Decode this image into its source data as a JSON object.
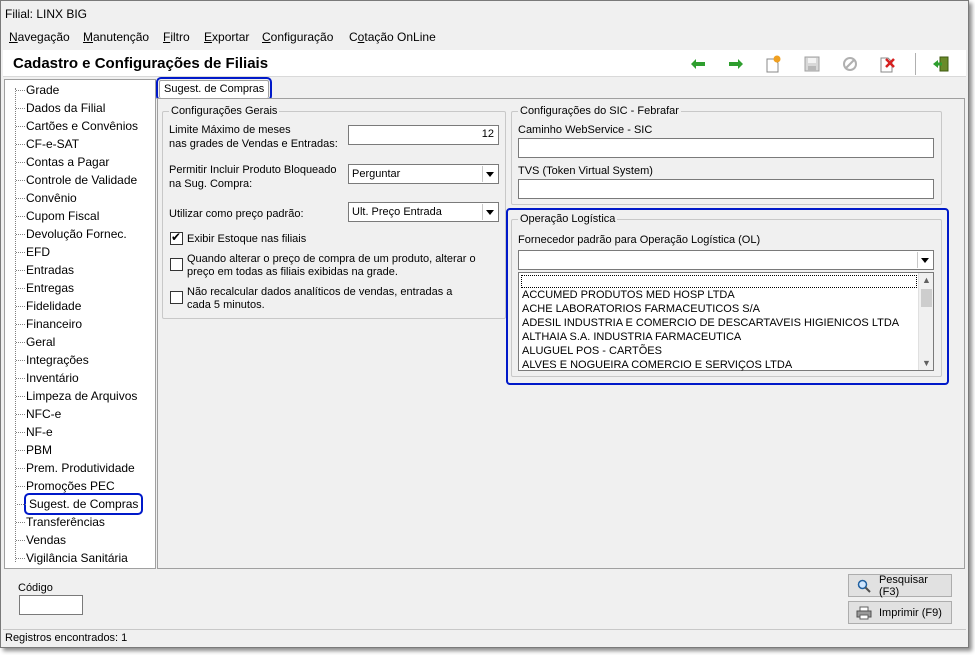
{
  "window": {
    "title": "Filial: LINX  BIG"
  },
  "menu": [
    {
      "label": "Navegação",
      "key": "N"
    },
    {
      "label": "Manutenção",
      "key": "M"
    },
    {
      "label": "Filtro",
      "key": "F"
    },
    {
      "label": "Exportar",
      "key": "E"
    },
    {
      "label": "Configuração",
      "key": "C"
    },
    {
      "label": "Cotação OnLine",
      "key": "o"
    }
  ],
  "header": {
    "title": "Cadastro e Configurações de Filiais"
  },
  "toolbar": {
    "icons": [
      "arrow-left-icon",
      "arrow-right-icon",
      "new-document-icon",
      "save-icon",
      "cancel-icon",
      "delete-icon",
      "exit-icon"
    ],
    "colors": {
      "arrow": "#2e9e2e",
      "delete": "#d62020",
      "new": "#f0a020"
    }
  },
  "sidebar": {
    "items": [
      "Grade",
      "Dados da Filial",
      "Cartões e Convênios",
      "CF-e-SAT",
      "Contas a Pagar",
      "Controle de Validade",
      "Convênio",
      "Cupom Fiscal",
      "Devolução Fornec.",
      "EFD",
      "Entradas",
      "Entregas",
      "Fidelidade",
      "Financeiro",
      "Geral",
      "Integrações",
      "Inventário",
      "Limpeza de Arquivos",
      "NFC-e",
      "NF-e",
      "PBM",
      "Prem. Produtividade",
      "Promoções PEC",
      "Sugest. de Compras",
      "Transferências",
      "Vendas",
      "Vigilância Sanitária"
    ],
    "selected": "Sugest. de Compras"
  },
  "tab": {
    "label": "Sugest. de Compras"
  },
  "general": {
    "title": "Configurações Gerais",
    "limit_label_1": "Limite Máximo de meses",
    "limit_label_2": "nas grades de Vendas e Entradas:",
    "limit_value": "12",
    "blocked_label_1": "Permitir Incluir Produto Bloqueado",
    "blocked_label_2": "na Sug. Compra:",
    "blocked_value": "Perguntar",
    "price_label": "Utilizar como preço padrão:",
    "price_value": "Ult. Preço Entrada",
    "chk_stock": {
      "label": "Exibir Estoque nas filiais",
      "checked": true
    },
    "chk_price_1": "Quando alterar o preço de compra de um produto, alterar o",
    "chk_price_2": "preço em todas as filiais exibidas na grade.",
    "chk_recalc_1": "Não recalcular dados analíticos de vendas, entradas a",
    "chk_recalc_2": "cada 5 minutos."
  },
  "sic": {
    "title": "Configurações do SIC - Febrafar",
    "ws_label": "Caminho WebService - SIC",
    "ws_value": "",
    "tvs_label": "TVS (Token Virtual System)",
    "tvs_value": ""
  },
  "logistics": {
    "title": "Operação Logística",
    "supplier_label": "Fornecedor padrão para Operação Logística (OL)",
    "supplier_value": "",
    "options": [
      "ACCUMED PRODUTOS MED HOSP LTDA",
      "ACHE LABORATORIOS FARMACEUTICOS S/A",
      "ADESIL INDUSTRIA E COMERCIO DE DESCARTAVEIS HIGIENICOS LTDA",
      "ALTHAIA S.A. INDUSTRIA FARMACEUTICA",
      "ALUGUEL POS - CARTÕES",
      "ALVES E NOGUEIRA COMERCIO E SERVIÇOS LTDA"
    ]
  },
  "bottom": {
    "code_label": "Código",
    "code_value": "",
    "search_label": "Pesquisar (F3)",
    "print_label": "Imprimir (F9)"
  },
  "status": {
    "text": "Registros encontrados: 1"
  },
  "colors": {
    "highlight": "#0019c9"
  }
}
